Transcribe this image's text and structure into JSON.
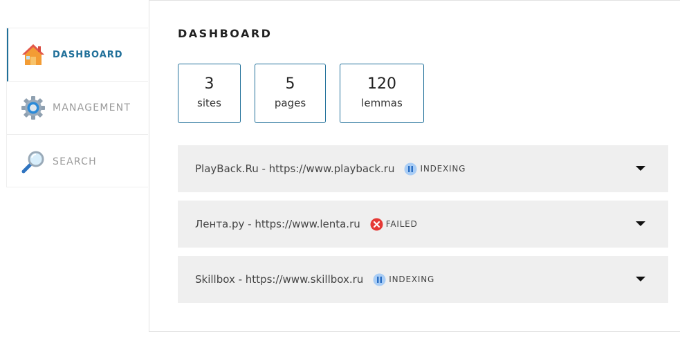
{
  "sidebar": {
    "items": [
      {
        "label": "DASHBOARD",
        "icon": "home-icon",
        "active": true
      },
      {
        "label": "MANAGEMENT",
        "icon": "gear-icon",
        "active": false
      },
      {
        "label": "SEARCH",
        "icon": "magnifier-icon",
        "active": false
      }
    ]
  },
  "main": {
    "title": "DASHBOARD",
    "stats": [
      {
        "value": "3",
        "label": "sites"
      },
      {
        "value": "5",
        "label": "pages"
      },
      {
        "value": "120",
        "label": "lemmas"
      }
    ],
    "sites": [
      {
        "name": "PlayBack.Ru - https://www.playback.ru",
        "status": "INDEXING",
        "status_icon": "pause-icon"
      },
      {
        "name": "Лента.ру - https://www.lenta.ru",
        "status": "FAILED",
        "status_icon": "error-icon"
      },
      {
        "name": "Skillbox - https://www.skillbox.ru",
        "status": "INDEXING",
        "status_icon": "pause-icon"
      }
    ]
  },
  "colors": {
    "accent": "#1f6f99",
    "row_background": "#efefef",
    "indexing_icon": "#7fb6f2",
    "failed_icon": "#e53935"
  }
}
